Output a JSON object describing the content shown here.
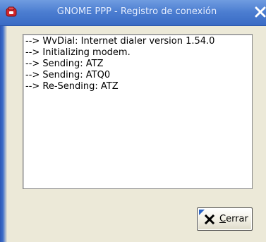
{
  "window": {
    "title": "GNOME PPP - Registro de conexión",
    "app_icon": "phone-icon",
    "close_icon": "close-icon"
  },
  "log": {
    "lines": [
      "--> WvDial: Internet dialer version 1.54.0",
      "--> Initializing modem.",
      "--> Sending: ATZ",
      "--> Sending: ATQ0",
      "--> Re-Sending: ATZ"
    ]
  },
  "actions": {
    "close_label_mnemonic": "C",
    "close_label_rest": "errar",
    "close_icon": "x-icon"
  },
  "colors": {
    "titlebar": "#4a7cd0",
    "title_text": "#e8f0ff",
    "dialog_bg": "#ece9d8",
    "log_bg": "#ffffff",
    "focus_mark": "#2c66c6"
  }
}
